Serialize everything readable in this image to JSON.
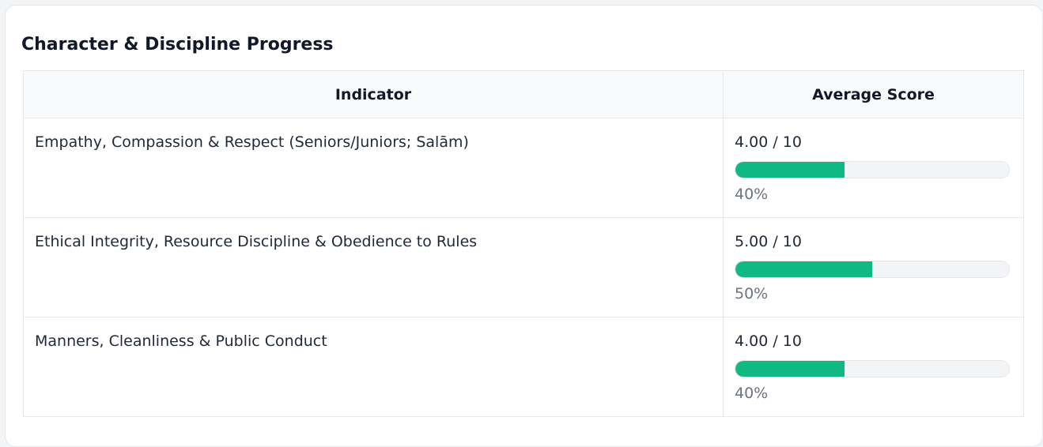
{
  "card": {
    "title": "Character & Discipline Progress"
  },
  "table": {
    "headers": {
      "indicator": "Indicator",
      "score": "Average Score"
    },
    "rows": [
      {
        "indicator": "Empathy, Compassion & Respect (Seniors/Juniors; Salām)",
        "score_text": "4.00 / 10",
        "percent_text": "40%",
        "progress": 0.4
      },
      {
        "indicator": "Ethical Integrity, Resource Discipline & Obedience to Rules",
        "score_text": "5.00 / 10",
        "percent_text": "50%",
        "progress": 0.5
      },
      {
        "indicator": "Manners, Cleanliness & Public Conduct",
        "score_text": "4.00 / 10",
        "percent_text": "40%",
        "progress": 0.4
      }
    ]
  },
  "colors": {
    "bar_fill": "#10b981",
    "bar_track": "#f3f4f6",
    "muted_text": "#6b7280"
  }
}
